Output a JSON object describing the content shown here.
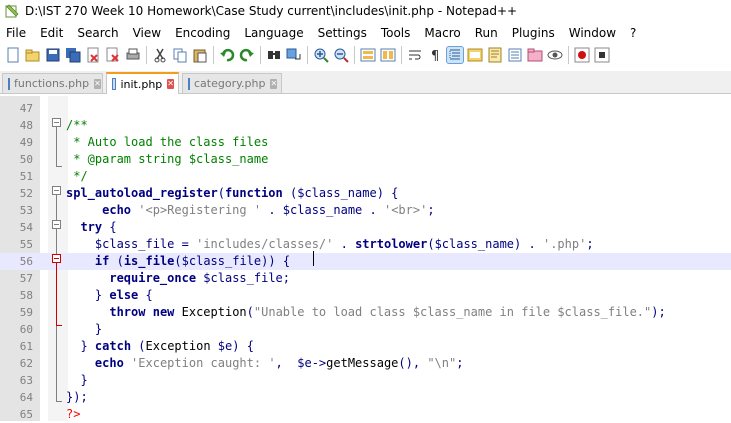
{
  "window": {
    "title": "D:\\IST 270 Week 10 Homework\\Case Study current\\includes\\init.php - Notepad++"
  },
  "menu": [
    "File",
    "Edit",
    "Search",
    "View",
    "Encoding",
    "Language",
    "Settings",
    "Tools",
    "Macro",
    "Run",
    "Plugins",
    "Window",
    "?"
  ],
  "toolbar_icons": [
    "new-file-icon",
    "open-file-icon",
    "save-icon",
    "save-all-icon",
    "close-icon",
    "close-all-icon",
    "print-icon",
    "cut-icon",
    "copy-icon",
    "paste-icon",
    "undo-icon",
    "redo-icon",
    "find-icon",
    "replace-icon",
    "zoom-in-icon",
    "zoom-out-icon",
    "sync-vertical-icon",
    "sync-horizontal-icon",
    "word-wrap-icon",
    "show-all-chars-icon",
    "indent-guide-icon",
    "language-icon",
    "doc-map-icon",
    "function-list-icon",
    "folder-workspace-icon",
    "monitoring-icon",
    "record-macro-icon"
  ],
  "tabs": [
    {
      "label": "functions.php",
      "active": false
    },
    {
      "label": "init.php",
      "active": true
    },
    {
      "label": "category.php",
      "active": false
    }
  ],
  "editor": {
    "lines": [
      {
        "n": "47",
        "tokens": []
      },
      {
        "n": "48",
        "tokens": [
          [
            "cm",
            "/**"
          ]
        ]
      },
      {
        "n": "49",
        "tokens": [
          [
            "cm",
            " * Auto load the class files"
          ]
        ]
      },
      {
        "n": "50",
        "tokens": [
          [
            "cm",
            " * @param string $class_name"
          ]
        ]
      },
      {
        "n": "51",
        "tokens": [
          [
            "cm",
            " */"
          ]
        ]
      },
      {
        "n": "52",
        "tokens": [
          [
            "kw",
            "spl_autoload_register"
          ],
          [
            "op",
            "("
          ],
          [
            "kw",
            "function"
          ],
          [
            "pl",
            " "
          ],
          [
            "op",
            "("
          ],
          [
            "vr",
            "$class_name"
          ],
          [
            "op",
            ")"
          ],
          [
            "pl",
            " "
          ],
          [
            "op",
            "{"
          ]
        ]
      },
      {
        "n": "53",
        "tokens": [
          [
            "pl",
            "     "
          ],
          [
            "kw",
            "echo"
          ],
          [
            "pl",
            " "
          ],
          [
            "st",
            "'<p>Registering '"
          ],
          [
            "pl",
            " "
          ],
          [
            "op",
            "."
          ],
          [
            "pl",
            " "
          ],
          [
            "vr",
            "$class_name"
          ],
          [
            "pl",
            " "
          ],
          [
            "op",
            "."
          ],
          [
            "pl",
            " "
          ],
          [
            "st",
            "'<br>'"
          ],
          [
            "op",
            ";"
          ]
        ]
      },
      {
        "n": "54",
        "tokens": [
          [
            "pl",
            "  "
          ],
          [
            "kw",
            "try"
          ],
          [
            "pl",
            " "
          ],
          [
            "op",
            "{"
          ]
        ]
      },
      {
        "n": "55",
        "tokens": [
          [
            "pl",
            "    "
          ],
          [
            "vr",
            "$class_file"
          ],
          [
            "pl",
            " "
          ],
          [
            "op",
            "="
          ],
          [
            "pl",
            " "
          ],
          [
            "st",
            "'includes/classes/'"
          ],
          [
            "pl",
            " "
          ],
          [
            "op",
            "."
          ],
          [
            "pl",
            " "
          ],
          [
            "kw",
            "strtolower"
          ],
          [
            "op",
            "("
          ],
          [
            "vr",
            "$class_name"
          ],
          [
            "op",
            ")"
          ],
          [
            "pl",
            " "
          ],
          [
            "op",
            "."
          ],
          [
            "pl",
            " "
          ],
          [
            "st",
            "'.php'"
          ],
          [
            "op",
            ";"
          ]
        ]
      },
      {
        "n": "56",
        "tokens": [
          [
            "pl",
            "    "
          ],
          [
            "kw",
            "if"
          ],
          [
            "pl",
            " "
          ],
          [
            "op",
            "("
          ],
          [
            "kw",
            "is_file"
          ],
          [
            "op",
            "("
          ],
          [
            "vr",
            "$class_file"
          ],
          [
            "op",
            "))"
          ],
          [
            "pl",
            " "
          ],
          [
            "op",
            "{"
          ]
        ]
      },
      {
        "n": "57",
        "tokens": [
          [
            "pl",
            "      "
          ],
          [
            "kw",
            "require_once"
          ],
          [
            "pl",
            " "
          ],
          [
            "vr",
            "$class_file"
          ],
          [
            "op",
            ";"
          ]
        ]
      },
      {
        "n": "58",
        "tokens": [
          [
            "pl",
            "    "
          ],
          [
            "op",
            "}"
          ],
          [
            "pl",
            " "
          ],
          [
            "kw",
            "else"
          ],
          [
            "pl",
            " "
          ],
          [
            "op",
            "{"
          ]
        ]
      },
      {
        "n": "59",
        "tokens": [
          [
            "pl",
            "      "
          ],
          [
            "kw",
            "throw"
          ],
          [
            "pl",
            " "
          ],
          [
            "kw",
            "new"
          ],
          [
            "pl",
            " Exception"
          ],
          [
            "op",
            "("
          ],
          [
            "st",
            "\"Unable to load class $class_name in file $class_file.\""
          ],
          [
            "op",
            ");"
          ]
        ]
      },
      {
        "n": "60",
        "tokens": [
          [
            "pl",
            "    "
          ],
          [
            "op",
            "}"
          ]
        ]
      },
      {
        "n": "61",
        "tokens": [
          [
            "pl",
            "  "
          ],
          [
            "op",
            "}"
          ],
          [
            "pl",
            " "
          ],
          [
            "kw",
            "catch"
          ],
          [
            "pl",
            " "
          ],
          [
            "op",
            "("
          ],
          [
            "pl",
            "Exception "
          ],
          [
            "vr",
            "$e"
          ],
          [
            "op",
            ")"
          ],
          [
            "pl",
            " "
          ],
          [
            "op",
            "{"
          ]
        ]
      },
      {
        "n": "62",
        "tokens": [
          [
            "pl",
            "    "
          ],
          [
            "kw",
            "echo"
          ],
          [
            "pl",
            " "
          ],
          [
            "st",
            "'Exception caught: '"
          ],
          [
            "op",
            ","
          ],
          [
            "pl",
            "  "
          ],
          [
            "vr",
            "$e"
          ],
          [
            "op",
            "->"
          ],
          [
            "pl",
            "getMessage"
          ],
          [
            "op",
            "(),"
          ],
          [
            "pl",
            " "
          ],
          [
            "st",
            "\"\\n\""
          ],
          [
            "op",
            ";"
          ]
        ]
      },
      {
        "n": "63",
        "tokens": [
          [
            "pl",
            "  "
          ],
          [
            "op",
            "}"
          ]
        ]
      },
      {
        "n": "64",
        "tokens": [
          [
            "op",
            "});"
          ]
        ]
      },
      {
        "n": "65",
        "tokens": [
          [
            "tag",
            "?>"
          ]
        ]
      }
    ]
  },
  "colors": {
    "tab_active_accent": "#f59d1b",
    "current_line": "#e8e8ff",
    "comment": "#008000",
    "keyword": "#000080",
    "string": "#808080",
    "php_tag": "#ff0000"
  }
}
